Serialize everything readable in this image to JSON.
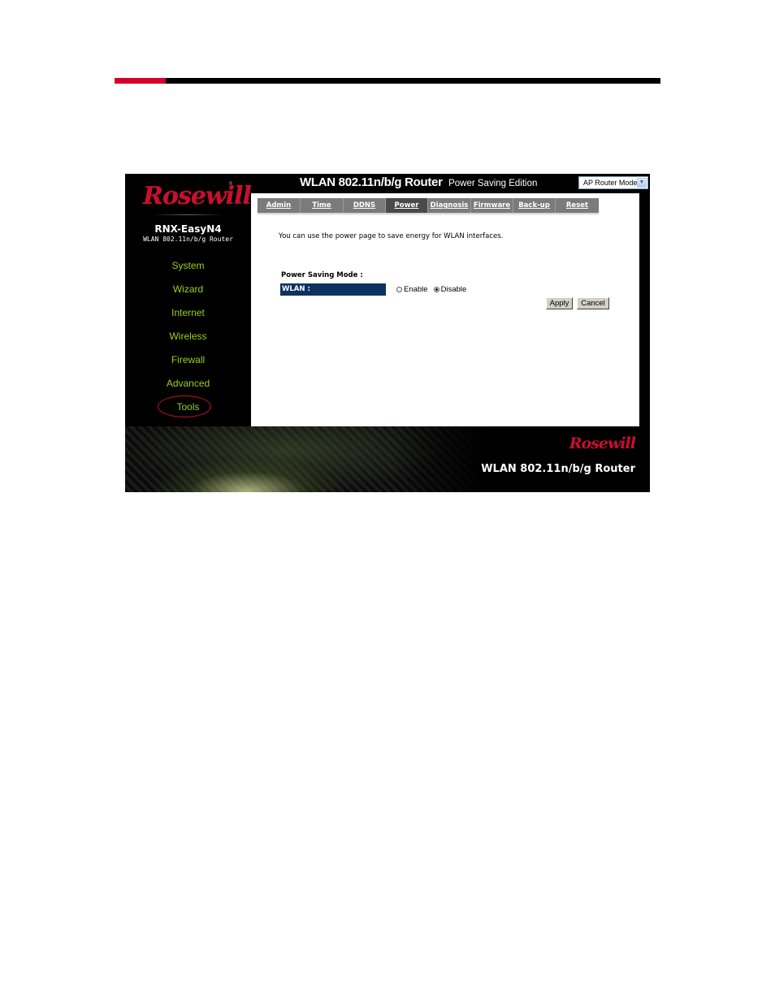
{
  "page": {
    "accent_color": "#d4002a"
  },
  "sidebar": {
    "logo": "Rosewill",
    "logo_mark": "®",
    "model": "RNX-EasyN4",
    "model_subtitle": "WLAN 802.11n/b/g Router",
    "items": [
      {
        "label": "System"
      },
      {
        "label": "Wizard"
      },
      {
        "label": "Internet"
      },
      {
        "label": "Wireless"
      },
      {
        "label": "Firewall"
      },
      {
        "label": "Advanced"
      },
      {
        "label": "Tools",
        "active": true
      }
    ],
    "nav_color": "#9bd11b",
    "highlight_color": "#c8102e"
  },
  "header": {
    "title": "WLAN 802.11n/b/g Router",
    "subtitle": "Power Saving Edition",
    "mode_select": {
      "selected": "AP Router Mode"
    }
  },
  "tabs": [
    {
      "label": "Admin"
    },
    {
      "label": "Time"
    },
    {
      "label": "DDNS"
    },
    {
      "label": "Power",
      "active": true
    },
    {
      "label": "Diagnosis"
    },
    {
      "label": "Firmware"
    },
    {
      "label": "Back-up"
    },
    {
      "label": "Reset"
    }
  ],
  "main": {
    "intro": "You can use the power page to save energy for WLAN interfaces.",
    "section_label": "Power Saving Mode :",
    "row_label": "WLAN :",
    "options": [
      {
        "label": "Enable",
        "checked": false
      },
      {
        "label": "Disable",
        "checked": true
      }
    ],
    "apply_label": "Apply",
    "cancel_label": "Cancel"
  },
  "footer": {
    "logo": "Rosewill",
    "title": "WLAN 802.11n/b/g Router"
  }
}
